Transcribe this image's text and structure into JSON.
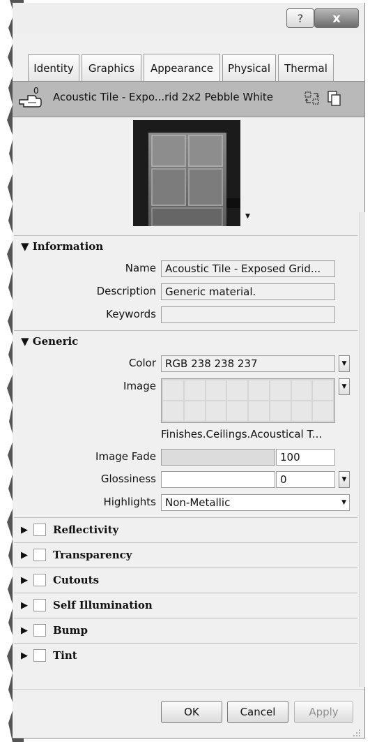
{
  "titlebar": {
    "help_label": "?",
    "close_label": "x"
  },
  "tabs": [
    "Identity",
    "Graphics",
    "Appearance",
    "Physical",
    "Thermal"
  ],
  "active_tab": "Appearance",
  "header": {
    "asset_count": "0",
    "asset_name": "Acoustic Tile - Expo...rid 2x2 Pebble White",
    "icons": [
      "replace-asset-icon",
      "duplicate-asset-icon"
    ]
  },
  "information": {
    "title": "Information",
    "name_label": "Name",
    "name_value": "Acoustic Tile - Exposed Grid...",
    "description_label": "Description",
    "description_value": "Generic material.",
    "keywords_label": "Keywords",
    "keywords_value": ""
  },
  "generic": {
    "title": "Generic",
    "color_label": "Color",
    "color_value": "RGB 238 238 237",
    "image_label": "Image",
    "image_caption": "Finishes.Ceilings.Acoustical T...",
    "image_fade_label": "Image Fade",
    "image_fade_value": "100",
    "glossiness_label": "Glossiness",
    "glossiness_value": "0",
    "highlights_label": "Highlights",
    "highlights_value": "Non-Metallic"
  },
  "collapsed_sections": [
    "Reflectivity",
    "Transparency",
    "Cutouts",
    "Self Illumination",
    "Bump",
    "Tint"
  ],
  "buttons": {
    "ok": "OK",
    "cancel": "Cancel",
    "apply": "Apply"
  },
  "colors": {
    "header_bg": "#b9b9b9",
    "panel_bg": "#f0f0f0",
    "close_button": "#7a7a7a"
  }
}
